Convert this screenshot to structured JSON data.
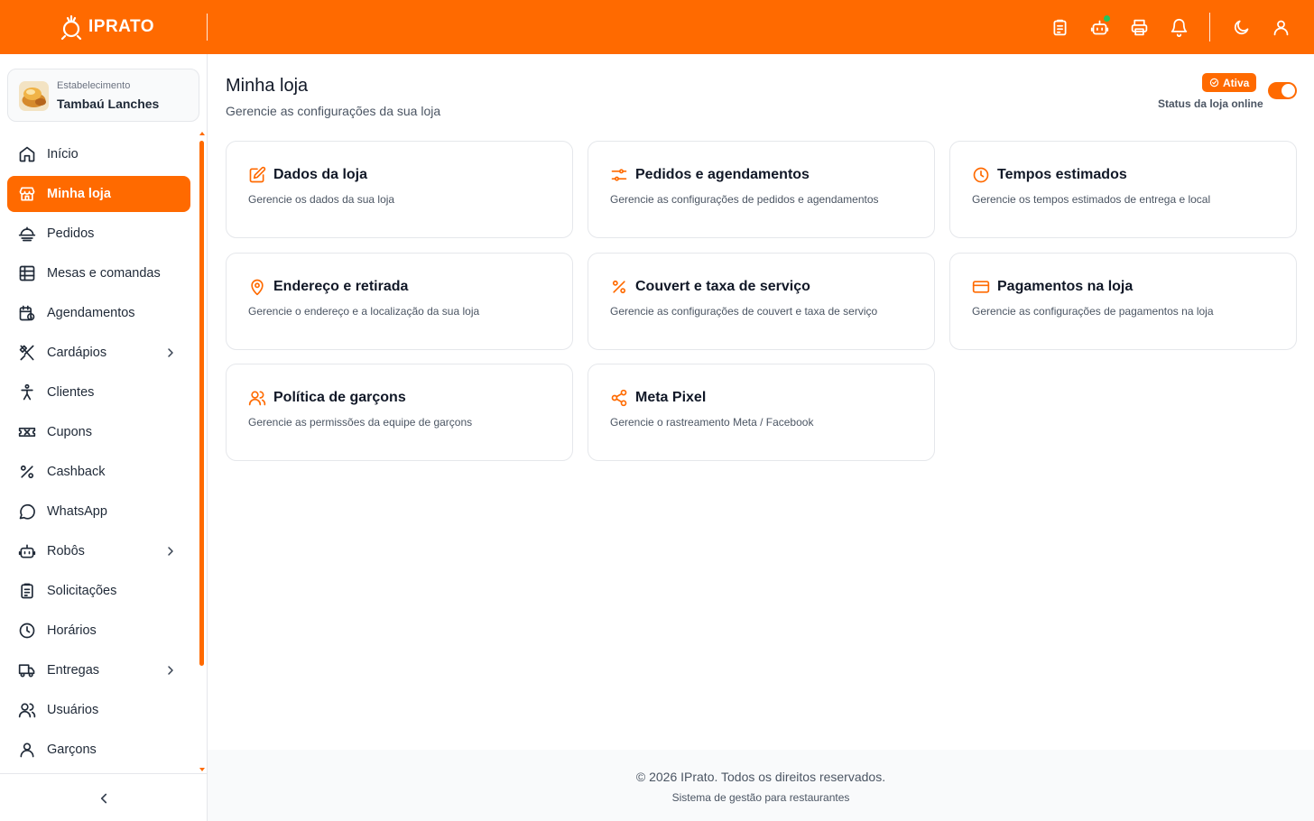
{
  "brand": {
    "name": "IPRATO"
  },
  "colors": {
    "primary": "#ff6a00",
    "online_dot": "#22c55e"
  },
  "topbar": {
    "icons": [
      "clipboard-icon",
      "robot-icon",
      "printer-icon",
      "bell-icon",
      "moon-icon",
      "user-icon"
    ]
  },
  "store": {
    "label": "Estabelecimento",
    "name": "Tambaú Lanches"
  },
  "sidebar": {
    "items": [
      {
        "label": "Início",
        "icon": "home-icon"
      },
      {
        "label": "Minha loja",
        "icon": "store-icon",
        "active": true
      },
      {
        "label": "Pedidos",
        "icon": "dish-icon"
      },
      {
        "label": "Mesas e comandas",
        "icon": "table-icon"
      },
      {
        "label": "Agendamentos",
        "icon": "calendar-icon"
      },
      {
        "label": "Cardápios",
        "icon": "utensils-icon",
        "submenu": true
      },
      {
        "label": "Clientes",
        "icon": "person-icon"
      },
      {
        "label": "Cupons",
        "icon": "ticket-icon"
      },
      {
        "label": "Cashback",
        "icon": "percent-icon"
      },
      {
        "label": "WhatsApp",
        "icon": "chat-icon"
      },
      {
        "label": "Robôs",
        "icon": "robot-icon",
        "submenu": true
      },
      {
        "label": "Solicitações",
        "icon": "clipboard-icon"
      },
      {
        "label": "Horários",
        "icon": "clock-icon"
      },
      {
        "label": "Entregas",
        "icon": "truck-icon",
        "submenu": true
      },
      {
        "label": "Usuários",
        "icon": "users-icon"
      },
      {
        "label": "Garçons",
        "icon": "user-icon"
      }
    ]
  },
  "page": {
    "title": "Minha loja",
    "subtitle": "Gerencie as configurações da sua loja",
    "status_badge": "Ativa",
    "status_label": "Status da loja online",
    "status_online": true
  },
  "cards": [
    {
      "title": "Dados da loja",
      "desc": "Gerencie os dados da sua loja",
      "icon": "edit-icon"
    },
    {
      "title": "Pedidos e agendamentos",
      "desc": "Gerencie as configurações de pedidos e agendamentos",
      "icon": "sliders-icon"
    },
    {
      "title": "Tempos estimados",
      "desc": "Gerencie os tempos estimados de entrega e local",
      "icon": "clock-icon"
    },
    {
      "title": "Endereço e retirada",
      "desc": "Gerencie o endereço e a localização da sua loja",
      "icon": "map-pin-icon"
    },
    {
      "title": "Couvert e taxa de serviço",
      "desc": "Gerencie as configurações de couvert e taxa de serviço",
      "icon": "percent-icon"
    },
    {
      "title": "Pagamentos na loja",
      "desc": "Gerencie as configurações de pagamentos na loja",
      "icon": "credit-card-icon"
    },
    {
      "title": "Política de garçons",
      "desc": "Gerencie as permissões da equipe de garçons",
      "icon": "users-icon"
    },
    {
      "title": "Meta Pixel",
      "desc": "Gerencie o rastreamento Meta / Facebook",
      "icon": "share-icon"
    }
  ],
  "footer": {
    "copyright": "© 2026 IPrato. Todos os direitos reservados.",
    "subtitle": "Sistema de gestão para restaurantes"
  }
}
